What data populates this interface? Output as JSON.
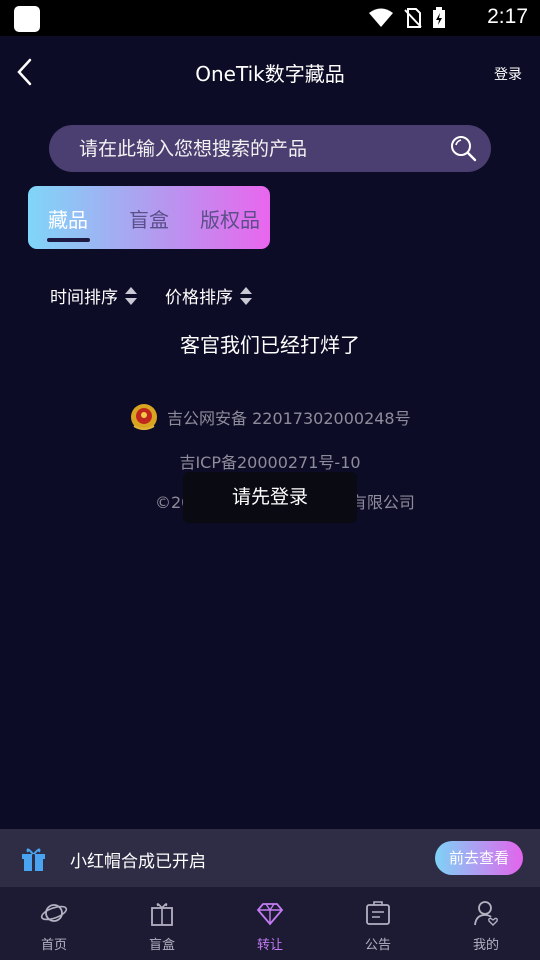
{
  "status_bar": {
    "time": "2:17"
  },
  "header": {
    "title": "OneTik数字藏品",
    "login": "登录"
  },
  "search": {
    "placeholder": "请在此输入您想搜索的产品"
  },
  "tabs": [
    {
      "label": "藏品",
      "active": true
    },
    {
      "label": "盲盒",
      "active": false
    },
    {
      "label": "版权品",
      "active": false
    }
  ],
  "sort": {
    "time_label": "时间排序",
    "price_label": "价格排序"
  },
  "empty_message": "客官我们已经打烊了",
  "footer": {
    "police_record": "吉公网安备 22017302000248号",
    "icp": "吉ICP备20000271号-10",
    "copyright": "©2021 长",
    "copyright_tail": "有限公司"
  },
  "toast": "请先登录",
  "banner": {
    "text": "小红帽合成已开启",
    "button": "前去查看"
  },
  "nav": [
    {
      "label": "首页",
      "icon": "planet-icon"
    },
    {
      "label": "盲盒",
      "icon": "gift-box-icon"
    },
    {
      "label": "转让",
      "icon": "diamond-icon",
      "active": true
    },
    {
      "label": "公告",
      "icon": "notice-icon"
    },
    {
      "label": "我的",
      "icon": "profile-icon"
    }
  ],
  "colors": {
    "background": "#0d0c26",
    "accent": "#c47cf5",
    "gradient_start": "#7fd6f8",
    "gradient_end": "#e966ee"
  }
}
